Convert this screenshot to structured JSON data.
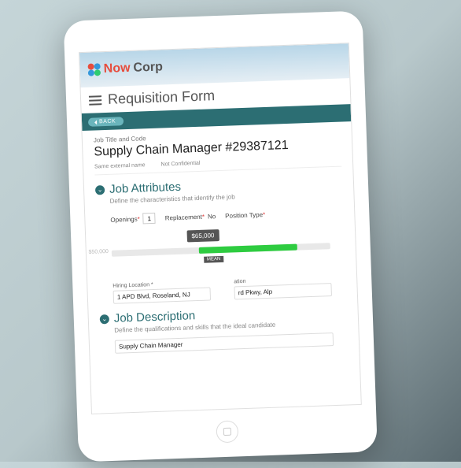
{
  "logo": {
    "now": "Now",
    "corp": "Corp"
  },
  "page_title": "Requisition Form",
  "back": "BACK",
  "job": {
    "label": "Job Title and Code",
    "title": "Supply Chain Manager #29387121",
    "meta1": "Same external name",
    "meta2": "Not Confidential"
  },
  "attributes": {
    "title": "Job Attributes",
    "subtitle": "Define the characteristics that identify the job",
    "openings_label": "Openings",
    "openings_value": "1",
    "replacement_label": "Replacement",
    "replacement_value": "No",
    "position_type_label": "Position Type"
  },
  "salary": {
    "tooltip": "$65,000",
    "min": "$50,000",
    "tag": "MEAN"
  },
  "hiring": {
    "label": "Hiring Location *",
    "value": "1 APD Blvd, Roseland, NJ",
    "other_label": "ation",
    "other_value": "rd Pkwy, Alp"
  },
  "description": {
    "title": "Job Description",
    "subtitle": "Define the qualifications and skills that the ideal candidate",
    "value": "Supply Chain Manager"
  }
}
